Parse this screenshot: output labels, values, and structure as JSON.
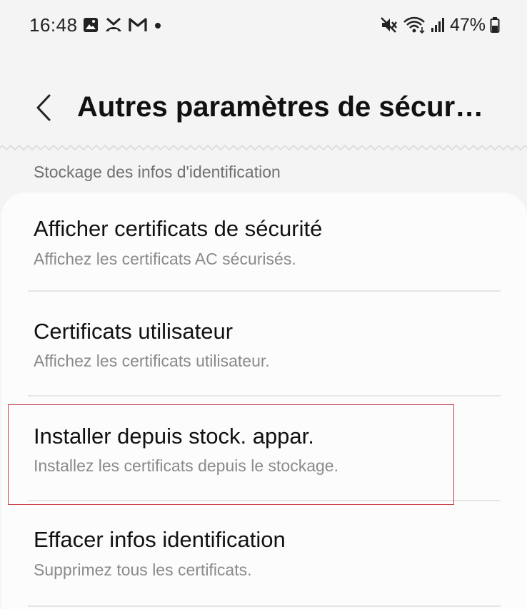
{
  "status_bar": {
    "time": "16:48",
    "battery": "47%",
    "left_icons": [
      "gallery-icon",
      "missed-call-icon",
      "gmail-icon",
      "notification-dot-icon"
    ],
    "right_icons": [
      "mute-icon",
      "wifi-icon",
      "signal-icon",
      "battery-icon"
    ]
  },
  "header": {
    "title": "Autres paramètres de sécur…"
  },
  "section": {
    "label": "Stockage des infos d'identification"
  },
  "items": [
    {
      "title": "Afficher certificats de sécurité",
      "subtitle": "Affichez les certificats AC sécurisés."
    },
    {
      "title": "Certificats utilisateur",
      "subtitle": "Affichez les certificats utilisateur."
    },
    {
      "title": "Installer depuis stock. appar.",
      "subtitle": "Installez les certificats depuis le stockage."
    },
    {
      "title": "Effacer infos identification",
      "subtitle": "Supprimez tous les certificats."
    }
  ],
  "colors": {
    "background": "#f4f4f4",
    "card": "#fcfcfc",
    "highlight": "#c9404c"
  }
}
